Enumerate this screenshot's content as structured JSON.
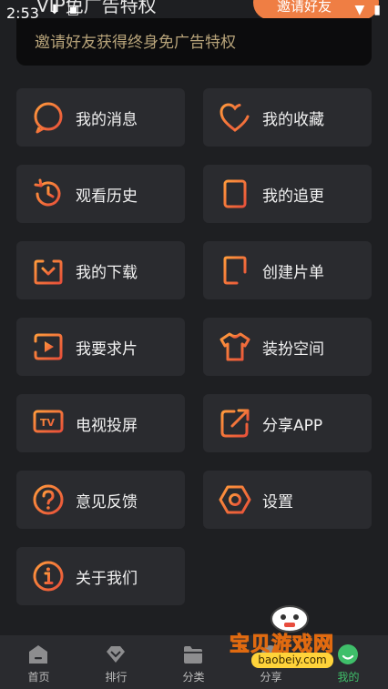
{
  "status_bar": {
    "time": "2:53"
  },
  "header": {
    "title": "VIP免广告特权",
    "invite_button": "邀请好友",
    "description": "邀请好友获得终身免广告特权"
  },
  "menu": [
    {
      "label": "我的消息",
      "icon": "message-icon"
    },
    {
      "label": "我的收藏",
      "icon": "heart-plus-icon"
    },
    {
      "label": "观看历史",
      "icon": "history-icon"
    },
    {
      "label": "我的追更",
      "icon": "document-list-icon"
    },
    {
      "label": "我的下载",
      "icon": "download-icon"
    },
    {
      "label": "创建片单",
      "icon": "create-playlist-icon"
    },
    {
      "label": "我要求片",
      "icon": "video-request-icon"
    },
    {
      "label": "装扮空间",
      "icon": "tshirt-icon"
    },
    {
      "label": "电视投屏",
      "icon": "tv-icon"
    },
    {
      "label": "分享APP",
      "icon": "share-icon"
    },
    {
      "label": "意见反馈",
      "icon": "question-icon"
    },
    {
      "label": "设置",
      "icon": "settings-icon"
    },
    {
      "label": "关于我们",
      "icon": "info-icon"
    }
  ],
  "bottom_nav": [
    {
      "label": "首页",
      "icon": "home-icon"
    },
    {
      "label": "排行",
      "icon": "ranking-icon"
    },
    {
      "label": "分类",
      "icon": "category-folder-icon"
    },
    {
      "label": "分享",
      "icon": "share-nav-icon"
    },
    {
      "label": "我的",
      "icon": "profile-icon",
      "active": true
    }
  ],
  "watermark": {
    "text": "宝贝游戏网",
    "url": "baobeiy.com"
  },
  "colors": {
    "accent": "#ef7e44",
    "icon_gradient_start": "#ff9a3c",
    "icon_gradient_end": "#e8503a",
    "active_nav": "#3fbf6a",
    "tile_bg": "#2a2b2f",
    "page_bg": "#1e1f22"
  }
}
